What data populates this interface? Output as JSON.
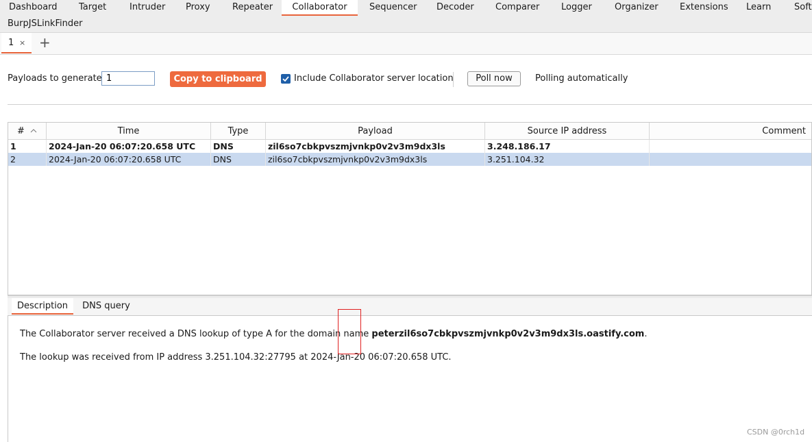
{
  "nav": {
    "tabs": [
      "Dashboard",
      "Target",
      "Intruder",
      "Proxy",
      "Repeater",
      "Collaborator",
      "Sequencer",
      "Decoder",
      "Comparer",
      "Logger",
      "Organizer",
      "Extensions",
      "Learn",
      "Softw"
    ],
    "active": "Collaborator",
    "extension_tab": "BurpJSLinkFinder"
  },
  "instance_tabs": {
    "tab1_label": "1",
    "close": "×",
    "add": "+"
  },
  "toolbar": {
    "payloads_label": "Payloads to generate:",
    "payloads_value": "1",
    "copy_button": "Copy to clipboard",
    "include_location_label": "Include Collaborator server location",
    "include_location_checked": true,
    "poll_button": "Poll now",
    "polling_status": "Polling automatically"
  },
  "table": {
    "headers": {
      "num": "#",
      "time": "Time",
      "type": "Type",
      "payload": "Payload",
      "source_ip": "Source IP address",
      "comment": "Comment"
    },
    "rows": [
      {
        "num": "1",
        "time": "2024-Jan-20 06:07:20.658 UTC",
        "type": "DNS",
        "payload": "zil6so7cbkpvszmjvnkp0v2v3m9dx3ls",
        "source_ip": "3.248.186.17",
        "comment": ""
      },
      {
        "num": "2",
        "time": "2024-Jan-20 06:07:20.658 UTC",
        "type": "DNS",
        "payload": "zil6so7cbkpvszmjvnkp0v2v3m9dx3ls",
        "source_ip": "3.251.104.32",
        "comment": ""
      }
    ]
  },
  "details": {
    "tabs": [
      "Description",
      "DNS query"
    ],
    "active": "Description",
    "line1_prefix": "The Collaborator server received a DNS lookup of type A for the domain name ",
    "line1_domain": "peterzil6so7cbkpvszmjvnkp0v2v3m9dx3ls.oastify.com",
    "line1_suffix": ".",
    "line2": "The lookup was received from IP address 3.251.104.32:27795 at 2024-Jan-20 06:07:20.658 UTC."
  },
  "watermark": "CSDN @0rch1d",
  "colors": {
    "accent": "#e8633a",
    "button": "#ee6a3e",
    "selection": "#c9d9ef",
    "checkbox": "#1f5fa8",
    "highlight_box": "#e02020"
  }
}
